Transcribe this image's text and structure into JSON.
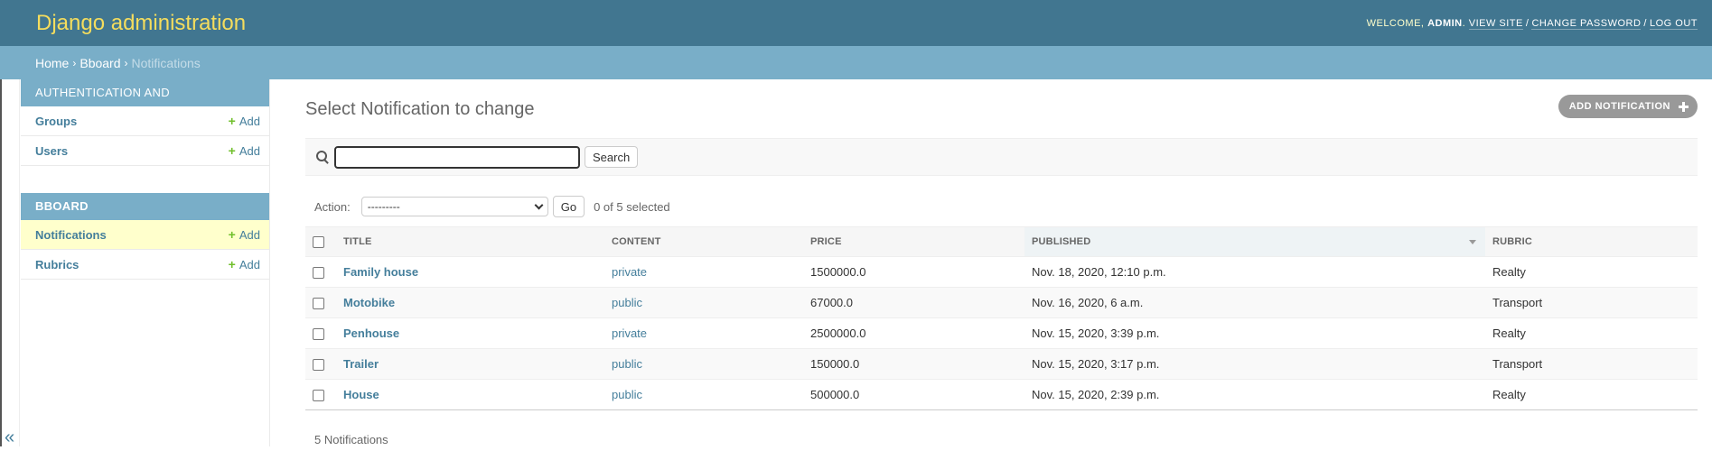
{
  "header": {
    "brand": "Django administration",
    "welcome": "Welcome,",
    "user": "admin",
    "view_site": "View site",
    "change_password": "Change password",
    "log_out": "Log out"
  },
  "breadcrumbs": {
    "home": "Home",
    "app": "Bboard",
    "current": "Notifications"
  },
  "sidebar": {
    "modules": [
      {
        "caption": "Authentication and Authorization",
        "items": [
          {
            "label": "Groups",
            "add": "Add"
          },
          {
            "label": "Users",
            "add": "Add"
          }
        ]
      },
      {
        "caption": "Bboard",
        "items": [
          {
            "label": "Notifications",
            "add": "Add"
          },
          {
            "label": "Rubrics",
            "add": "Add"
          }
        ]
      }
    ],
    "collapse_glyph": "«"
  },
  "page": {
    "title": "Select Notification to change",
    "add_button": "Add notification",
    "search_button": "Search",
    "search_value": "",
    "action_label": "Action:",
    "action_selected": "---------",
    "go_button": "Go",
    "selected_counter": "0 of 5 selected",
    "columns": [
      "Title",
      "Content",
      "Price",
      "Published",
      "Rubric"
    ],
    "rows": [
      {
        "title": "Family house",
        "content": "private",
        "price": "1500000.0",
        "published": "Nov. 18, 2020, 12:10 p.m.",
        "rubric": "Realty"
      },
      {
        "title": "Motobike",
        "content": "public",
        "price": "67000.0",
        "published": "Nov. 16, 2020, 6 a.m.",
        "rubric": "Transport"
      },
      {
        "title": "Penhouse",
        "content": "private",
        "price": "2500000.0",
        "published": "Nov. 15, 2020, 3:39 p.m.",
        "rubric": "Realty"
      },
      {
        "title": "Trailer",
        "content": "public",
        "price": "150000.0",
        "published": "Nov. 15, 2020, 3:17 p.m.",
        "rubric": "Transport"
      },
      {
        "title": "House",
        "content": "public",
        "price": "500000.0",
        "published": "Nov. 15, 2020, 2:39 p.m.",
        "rubric": "Realty"
      }
    ],
    "paginator": "5 Notifications"
  },
  "colors": {
    "header": "#417690",
    "breadcrumbs": "#79aec8",
    "brand": "#f5dd5d",
    "link": "#447e9b",
    "add_plus": "#70bf2b",
    "current_row": "#ffffcc"
  },
  "icons": {
    "search": "search-icon",
    "add": "plus-icon",
    "sort": "sort-desc-icon"
  }
}
